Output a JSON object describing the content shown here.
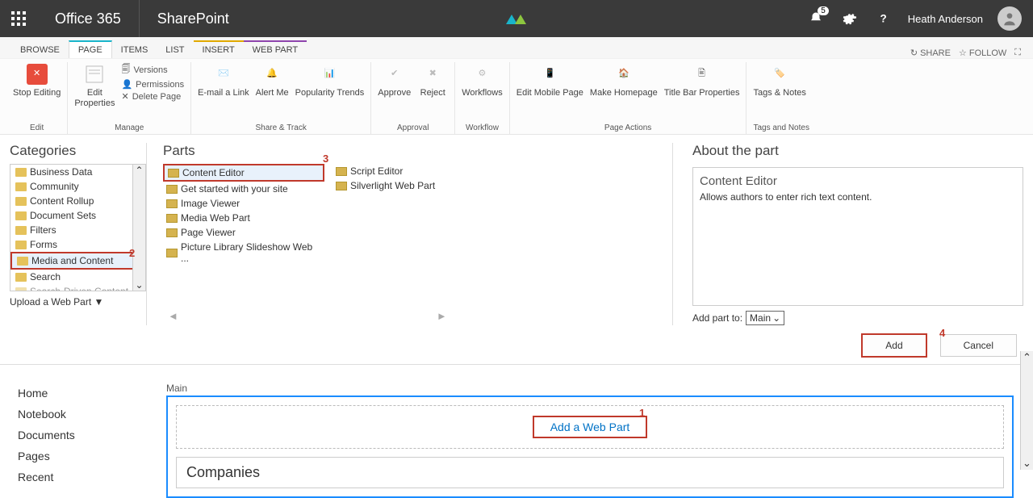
{
  "topbar": {
    "brand": "Office 365",
    "app": "SharePoint",
    "notif_count": "5",
    "user_name": "Heath Anderson"
  },
  "tabs": {
    "browse": "BROWSE",
    "page": "PAGE",
    "items": "ITEMS",
    "list": "LIST",
    "insert": "INSERT",
    "webpart": "WEB PART",
    "share": "SHARE",
    "follow": "FOLLOW"
  },
  "ribbon": {
    "stop_editing": "Stop Editing",
    "edit_group": "Edit",
    "edit_properties": "Edit\nProperties",
    "versions": "Versions",
    "permissions": "Permissions",
    "delete_page": "Delete Page",
    "manage_group": "Manage",
    "email_link": "E-mail a Link",
    "alert_me": "Alert Me",
    "pop_trends": "Popularity Trends",
    "share_group": "Share & Track",
    "approve": "Approve",
    "reject": "Reject",
    "approval_group": "Approval",
    "workflows": "Workflows",
    "workflow_group": "Workflow",
    "edit_mobile": "Edit Mobile Page",
    "make_home": "Make Homepage",
    "titlebar": "Title Bar Properties",
    "page_actions_group": "Page Actions",
    "tags_notes": "Tags & Notes",
    "tags_group": "Tags and Notes"
  },
  "gallery": {
    "categories_hdr": "Categories",
    "parts_hdr": "Parts",
    "about_hdr": "About the part",
    "categories": [
      "Business Data",
      "Community",
      "Content Rollup",
      "Document Sets",
      "Filters",
      "Forms",
      "Media and Content",
      "Search",
      "Search-Driven Content"
    ],
    "selected_category_index": 6,
    "parts_col1": [
      "Content Editor",
      "Get started with your site",
      "Image Viewer",
      "Media Web Part",
      "Page Viewer",
      "Picture Library Slideshow Web ..."
    ],
    "parts_col2": [
      "Script Editor",
      "Silverlight Web Part"
    ],
    "selected_part_index": 0,
    "upload": "Upload a Web Part ▼",
    "about_title": "Content Editor",
    "about_desc": "Allows authors to enter rich text content.",
    "add_to_label": "Add part to:",
    "add_to_value": "Main",
    "add_btn": "Add",
    "cancel_btn": "Cancel"
  },
  "sidenav": [
    "Home",
    "Notebook",
    "Documents",
    "Pages",
    "Recent"
  ],
  "editor": {
    "zone_label": "Main",
    "add_wp": "Add a Web Part",
    "wp_title": "Companies"
  },
  "callouts": {
    "c1": "1",
    "c2": "2",
    "c3": "3",
    "c4": "4"
  }
}
